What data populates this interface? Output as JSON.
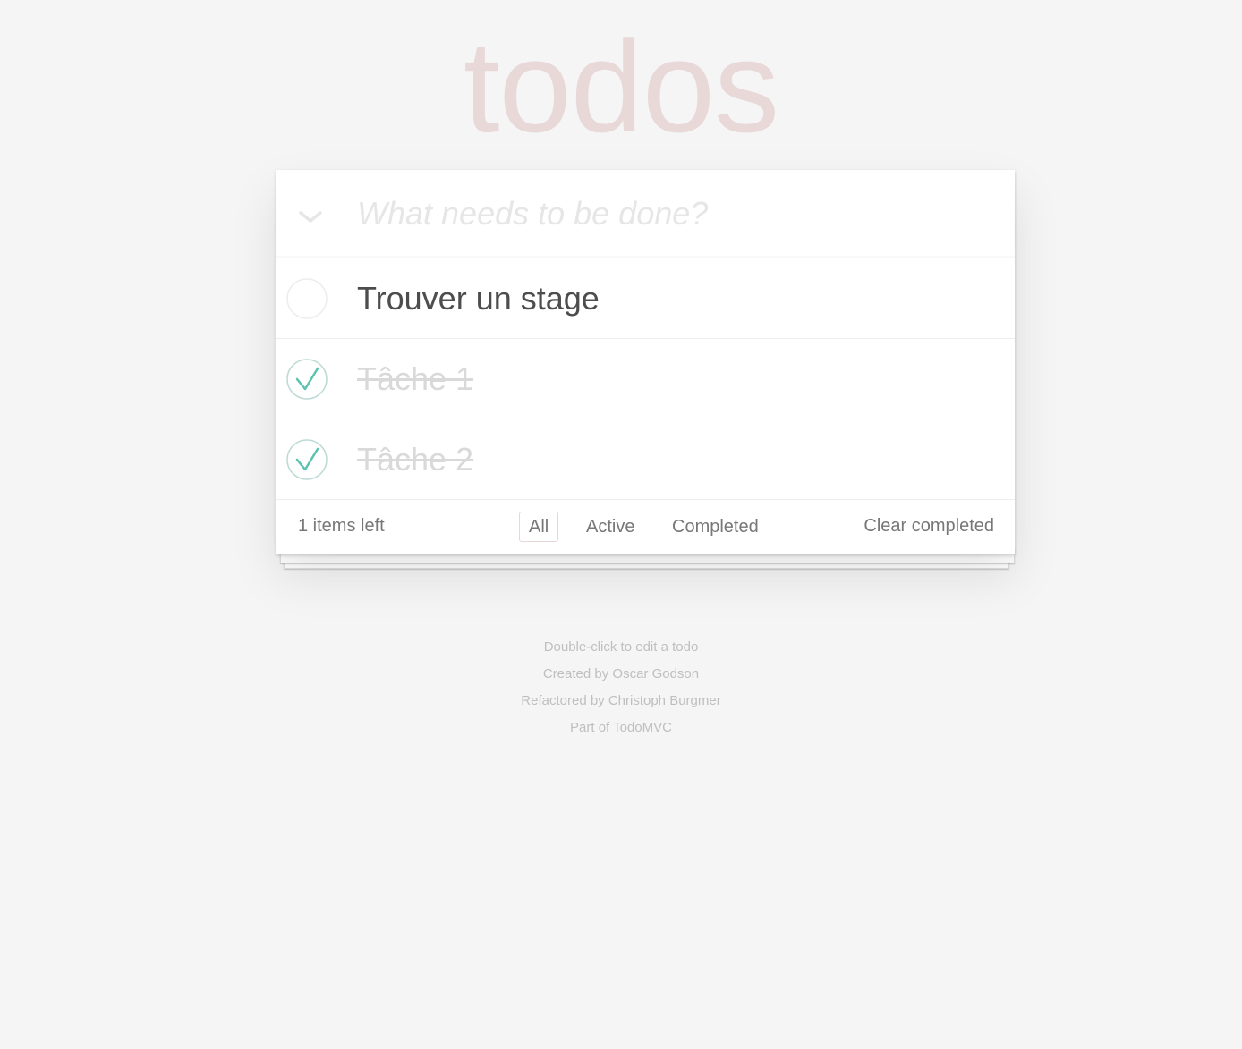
{
  "header": {
    "title": "todos",
    "new_todo_placeholder": "What needs to be done?",
    "toggle_all_icon": "chevron-down-icon"
  },
  "todos": [
    {
      "label": "Trouver un stage",
      "completed": false
    },
    {
      "label": "Tâche 1",
      "completed": true
    },
    {
      "label": "Tâche 2",
      "completed": true
    }
  ],
  "footer": {
    "items_left": "1 items left",
    "filters": [
      {
        "label": "All",
        "selected": true
      },
      {
        "label": "Active",
        "selected": false
      },
      {
        "label": "Completed",
        "selected": false
      }
    ],
    "clear_completed": "Clear completed"
  },
  "info": {
    "line1": "Double-click to edit a todo",
    "line2": "Created by Oscar Godson",
    "line3": "Refactored by Christoph Burgmer",
    "line4": "Part of TodoMVC"
  },
  "colors": {
    "background": "#f5f5f5",
    "title": "#e9d8d8",
    "check_accent": "#5dc2af",
    "check_ring_done": "#bddad5",
    "check_ring_empty": "#ededed",
    "completed_text": "#d9d9d9",
    "filter_selected_border": "#e8d7d7"
  }
}
